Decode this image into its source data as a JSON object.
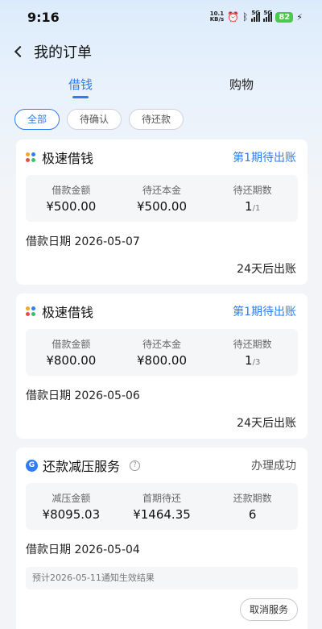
{
  "status_bar": {
    "time": "9:16",
    "net_speed_value": "10.1",
    "net_speed_unit": "KB/s",
    "signal1_label": "5G",
    "signal2_label": "5G",
    "battery": "82"
  },
  "header": {
    "title": "我的订单"
  },
  "tabs": [
    {
      "label": "借钱",
      "active": true
    },
    {
      "label": "购物",
      "active": false
    }
  ],
  "filters": [
    {
      "label": "全部",
      "active": true
    },
    {
      "label": "待确认",
      "active": false
    },
    {
      "label": "待还款",
      "active": false
    }
  ],
  "orders": [
    {
      "title": "极速借钱",
      "status": "第1期待出账",
      "stats": [
        {
          "label": "借款金额",
          "value": "¥500.00"
        },
        {
          "label": "待还本金",
          "value": "¥500.00"
        },
        {
          "label": "待还期数",
          "value": "1",
          "suffix": "/1"
        }
      ],
      "loan_date": "借款日期 2026-05-07",
      "bill_note": "24天后出账"
    },
    {
      "title": "极速借钱",
      "status": "第1期待出账",
      "stats": [
        {
          "label": "借款金额",
          "value": "¥800.00"
        },
        {
          "label": "待还本金",
          "value": "¥800.00"
        },
        {
          "label": "待还期数",
          "value": "1",
          "suffix": "/3"
        }
      ],
      "loan_date": "借款日期 2026-05-06",
      "bill_note": "24天后出账"
    },
    {
      "title": "还款减压服务",
      "status": "办理成功",
      "stats": [
        {
          "label": "减压金额",
          "value": "¥8095.03"
        },
        {
          "label": "首期待还",
          "value": "¥1464.35"
        },
        {
          "label": "还款期数",
          "value": "6"
        }
      ],
      "loan_date": "借款日期 2026-05-04",
      "notice": "预计2026-05-11通知生效结果",
      "cancel_label": "取消服务"
    }
  ],
  "colors": {
    "accent": "#2f7cf6",
    "battery": "#4ac94a",
    "app_icon_dots": [
      "#f5a623",
      "#2f7cf6",
      "#e94b4b",
      "#34c26b"
    ]
  }
}
